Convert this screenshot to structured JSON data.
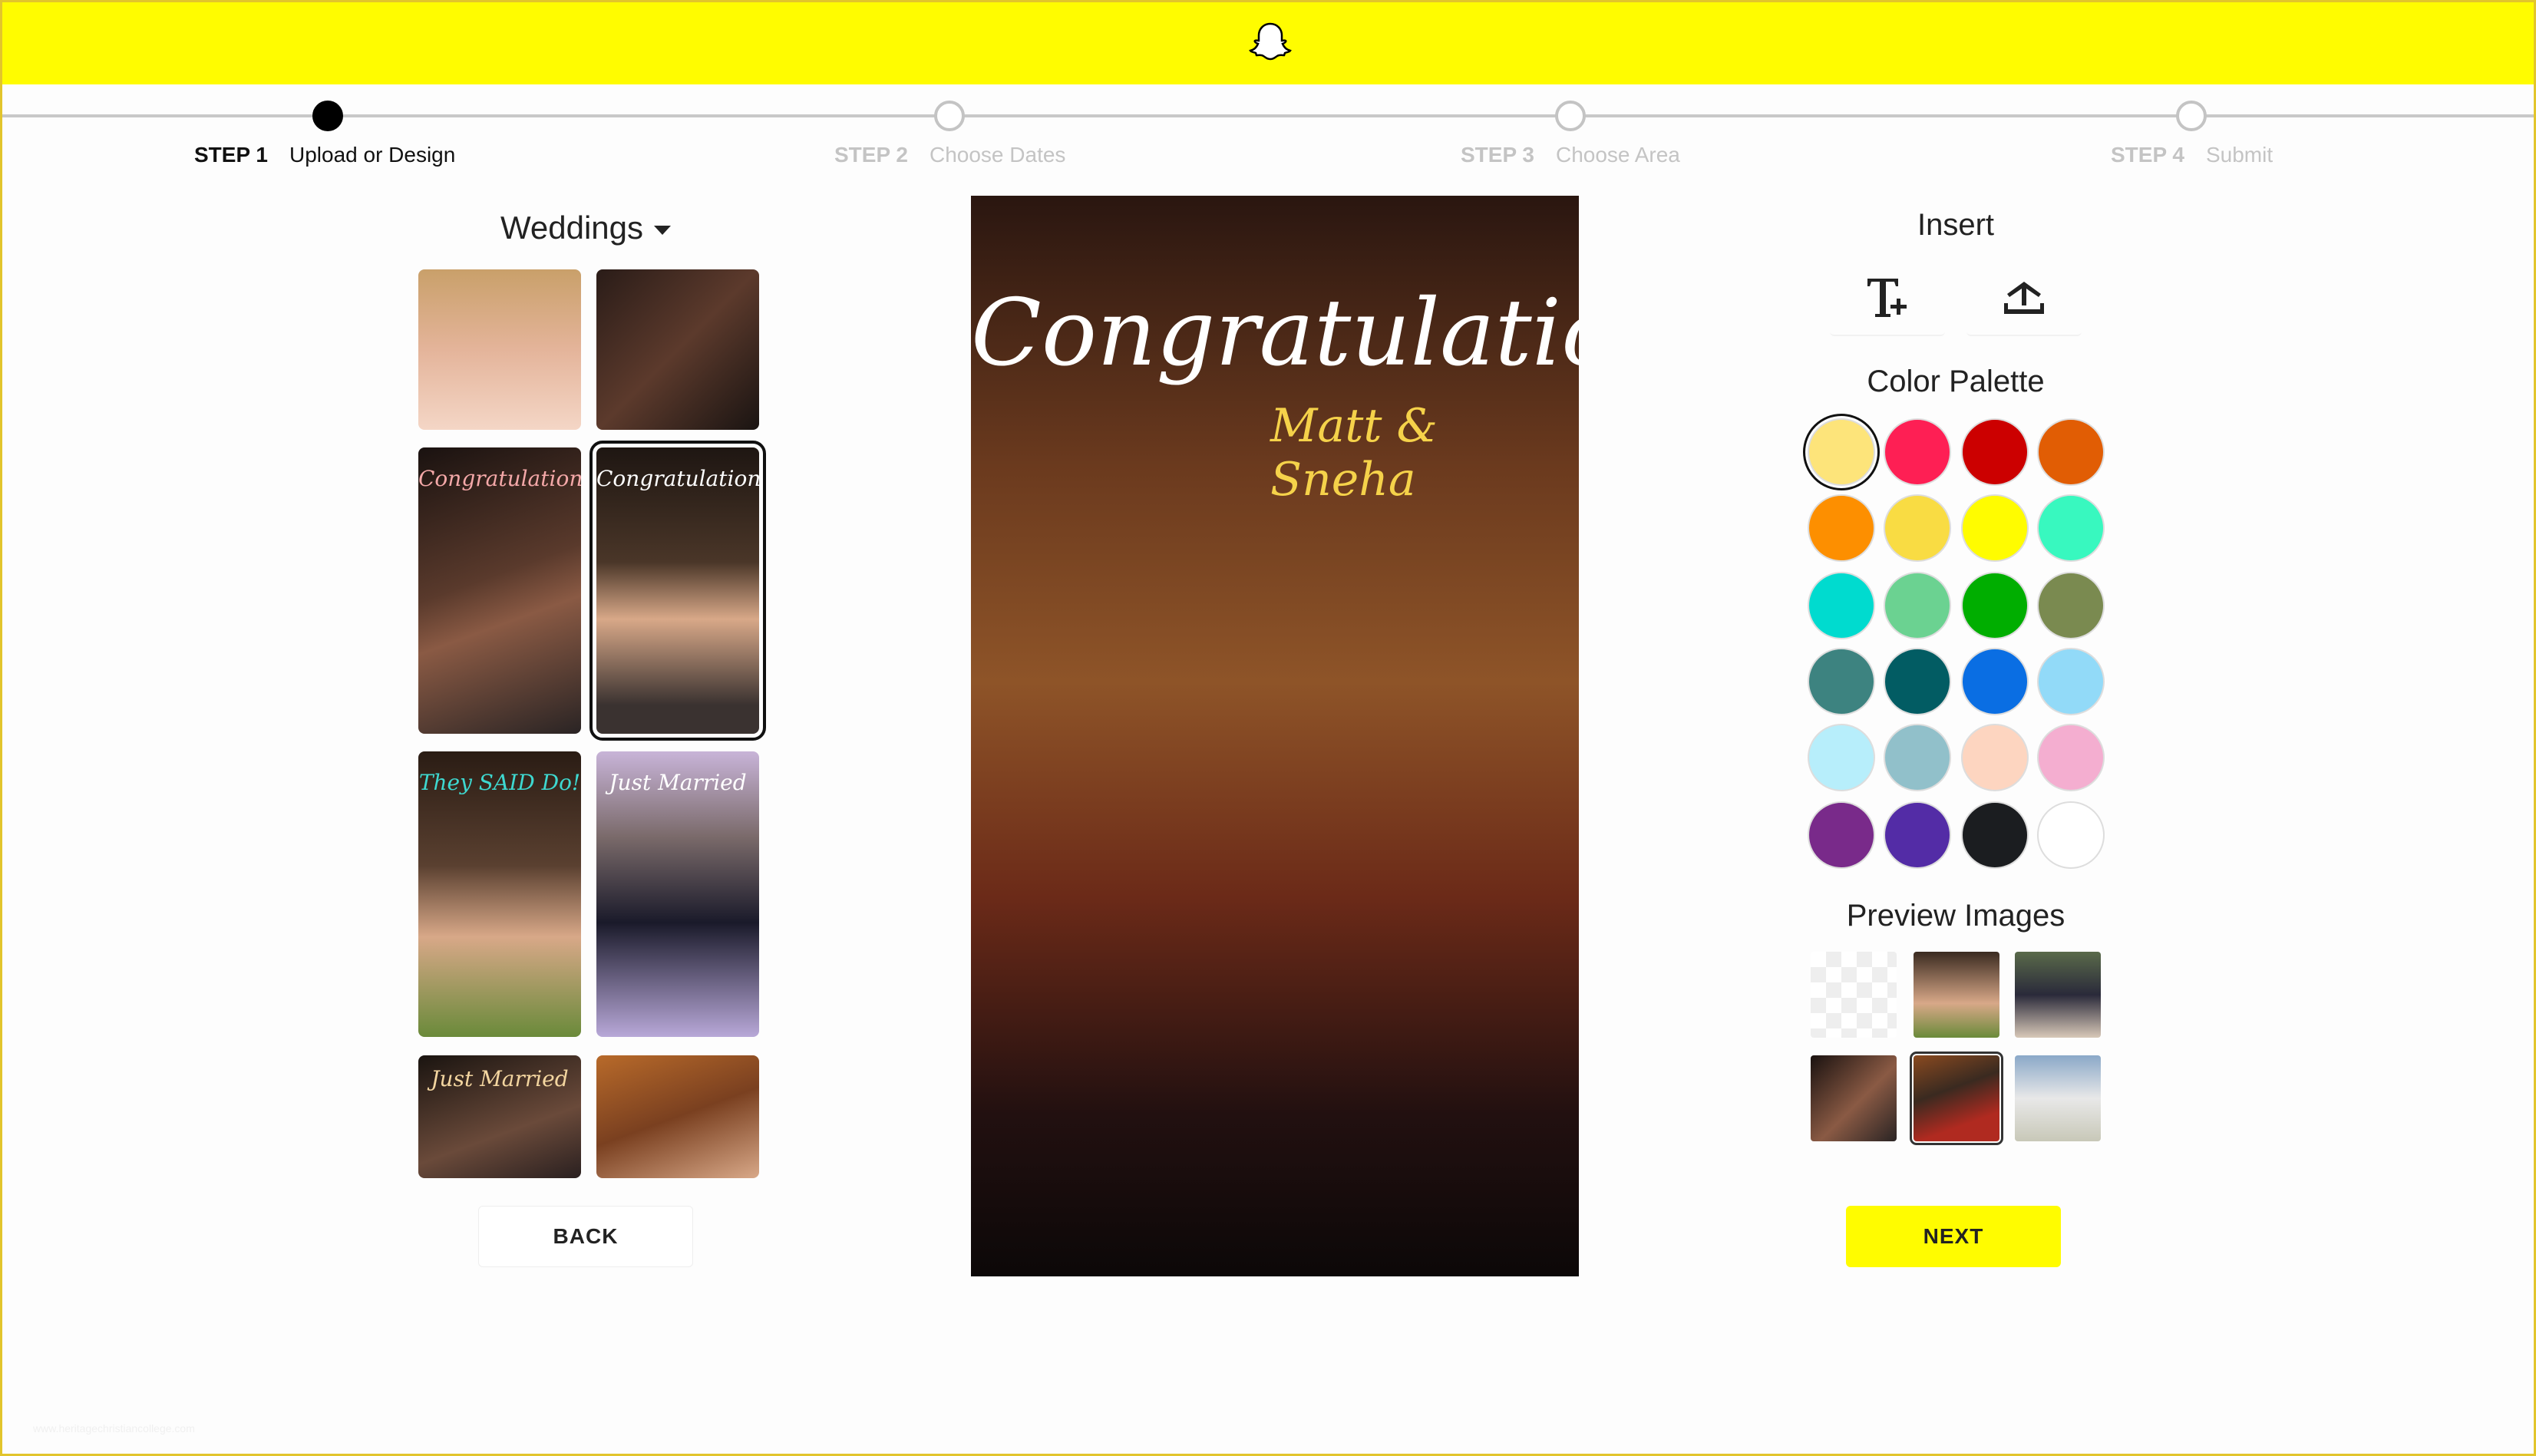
{
  "header": {
    "logo": "snapchat-ghost-icon",
    "bg": "#fffc00"
  },
  "steps": [
    {
      "num": "STEP 1",
      "label": "Upload or Design",
      "active": true
    },
    {
      "num": "STEP 2",
      "label": "Choose Dates",
      "active": false
    },
    {
      "num": "STEP 3",
      "label": "Choose Area",
      "active": false
    },
    {
      "num": "STEP 4",
      "label": "Submit",
      "active": false
    }
  ],
  "gallery": {
    "category": "Weddings",
    "thumbs": [
      {
        "title": ""
      },
      {
        "title": ""
      },
      {
        "title": "Congratulations"
      },
      {
        "title": "Congratulations"
      },
      {
        "title": "They SAID Do!"
      },
      {
        "title": "Just Married"
      },
      {
        "title": "Just Married"
      },
      {
        "title": ""
      }
    ],
    "back_label": "BACK"
  },
  "preview": {
    "title": "Congratulations",
    "subtitle": "Matt & Sneha"
  },
  "insert": {
    "title": "Insert",
    "tools": [
      "text-add-icon",
      "upload-icon"
    ]
  },
  "palette": {
    "title": "Color Palette",
    "selected": "#fde47a",
    "colors": [
      "#fde47a",
      "#fe1f54",
      "#cc0000",
      "#e15d04",
      "#fd8f00",
      "#f9dc43",
      "#fffc00",
      "#38f8bf",
      "#00dbcf",
      "#6bd291",
      "#00ae00",
      "#7a8a50",
      "#3d8380",
      "#025c63",
      "#0a6ee3",
      "#92daf8",
      "#b7eefb",
      "#91c0ca",
      "#fdd5c0",
      "#f4aed0",
      "#792a8a",
      "#532ca6",
      "#1b1d20",
      "#ffffff"
    ]
  },
  "preview_images": {
    "title": "Preview Images",
    "count": 6,
    "selected_index": 4
  },
  "next_label": "NEXT",
  "watermark": "www.heritagechristiancollege.com"
}
